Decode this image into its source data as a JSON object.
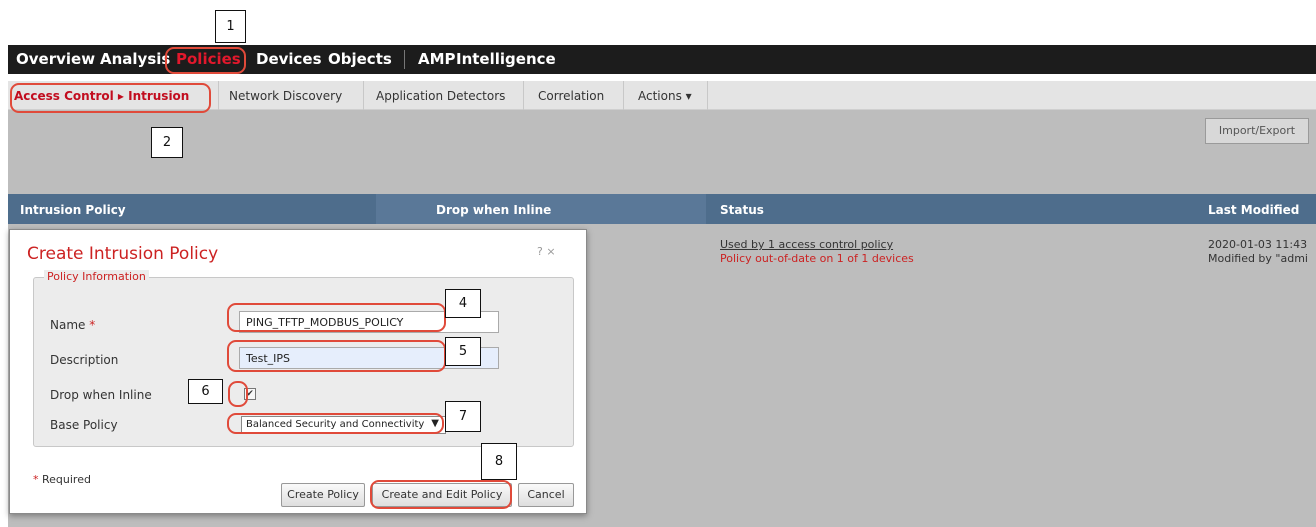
{
  "topnav": {
    "items": [
      "Overview",
      "Analysis",
      "Policies",
      "Devices",
      "Objects",
      "AMP",
      "Intelligence"
    ]
  },
  "subnav": {
    "breadcrumb": "Access Control ▸ Intrusion",
    "items": [
      "Network Discovery",
      "Application Detectors",
      "Correlation",
      "Actions ▾"
    ]
  },
  "toolbar": {
    "import_export": "Import/Export"
  },
  "table": {
    "headers": [
      "Intrusion Policy",
      "Drop when Inline",
      "Status",
      "Last Modified"
    ],
    "row": {
      "status_link": "Used by 1 access control policy",
      "status_warning": "Policy out-of-date on 1 of 1 devices",
      "modified_date": "2020-01-03 11:43",
      "modified_by": "Modified by \"admi"
    }
  },
  "dialog": {
    "title": "Create Intrusion Policy",
    "icons": "? ×",
    "legend": "Policy Information",
    "name_label": "Name",
    "required_mark": "*",
    "name_value": "PING_TFTP_MODBUS_POLICY",
    "description_label": "Description",
    "description_value": "Test_IPS",
    "drop_label": "Drop when Inline",
    "drop_checked": true,
    "base_label": "Base Policy",
    "base_value": "Balanced Security and Connectivity",
    "required_note": "Required",
    "buttons": {
      "create": "Create Policy",
      "create_edit": "Create and Edit Policy",
      "cancel": "Cancel"
    }
  },
  "callouts": [
    "1",
    "2",
    "4",
    "5",
    "6",
    "7",
    "8"
  ],
  "colors": {
    "nav_bg": "#1c1c1c",
    "accent_red": "#e2182c",
    "table_header": "#4e6d8c",
    "highlight": "#e04a3a"
  }
}
